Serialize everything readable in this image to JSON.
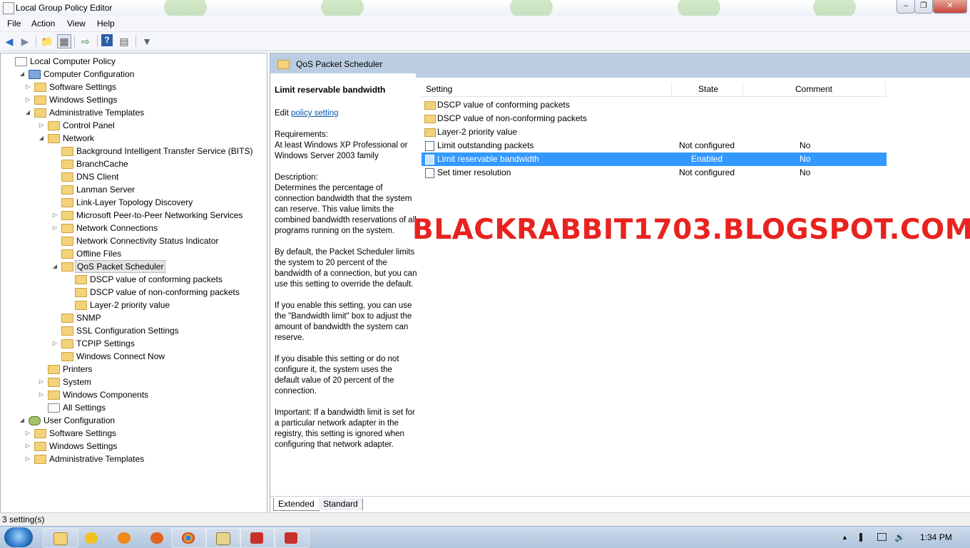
{
  "window": {
    "title": "Local Group Policy Editor"
  },
  "menu": [
    "File",
    "Action",
    "View",
    "Help"
  ],
  "toolbar": {
    "icons": [
      "back-arrow-icon",
      "forward-arrow-icon",
      "up-folder-icon",
      "show-hide-tree-icon",
      "export-list-icon",
      "help-icon",
      "properties-icon",
      "filter-icon"
    ]
  },
  "tree": [
    {
      "label": "Local Computer Policy",
      "level": 0,
      "icon": "doc",
      "arrow": ""
    },
    {
      "label": "Computer Configuration",
      "level": 1,
      "icon": "pc",
      "arrow": "open"
    },
    {
      "label": "Software Settings",
      "level": 2,
      "icon": "folder",
      "arrow": "closed"
    },
    {
      "label": "Windows Settings",
      "level": 2,
      "icon": "folder",
      "arrow": "closed"
    },
    {
      "label": "Administrative Templates",
      "level": 2,
      "icon": "folder",
      "arrow": "open"
    },
    {
      "label": "Control Panel",
      "level": 3,
      "icon": "folder",
      "arrow": "closed"
    },
    {
      "label": "Network",
      "level": 3,
      "icon": "folder",
      "arrow": "open"
    },
    {
      "label": "Background Intelligent Transfer Service (BITS)",
      "level": 4,
      "icon": "folder",
      "arrow": ""
    },
    {
      "label": "BranchCache",
      "level": 4,
      "icon": "folder",
      "arrow": ""
    },
    {
      "label": "DNS Client",
      "level": 4,
      "icon": "folder",
      "arrow": ""
    },
    {
      "label": "Lanman Server",
      "level": 4,
      "icon": "folder",
      "arrow": ""
    },
    {
      "label": "Link-Layer Topology Discovery",
      "level": 4,
      "icon": "folder",
      "arrow": ""
    },
    {
      "label": "Microsoft Peer-to-Peer Networking Services",
      "level": 4,
      "icon": "folder",
      "arrow": "closed"
    },
    {
      "label": "Network Connections",
      "level": 4,
      "icon": "folder",
      "arrow": "closed"
    },
    {
      "label": "Network Connectivity Status Indicator",
      "level": 4,
      "icon": "folder",
      "arrow": ""
    },
    {
      "label": "Offline Files",
      "level": 4,
      "icon": "folder",
      "arrow": ""
    },
    {
      "label": "QoS Packet Scheduler",
      "level": 4,
      "icon": "folder",
      "arrow": "open",
      "selected": true
    },
    {
      "label": "DSCP value of conforming packets",
      "level": 5,
      "icon": "folder",
      "arrow": ""
    },
    {
      "label": "DSCP value of non-conforming packets",
      "level": 5,
      "icon": "folder",
      "arrow": ""
    },
    {
      "label": "Layer-2 priority value",
      "level": 5,
      "icon": "folder",
      "arrow": ""
    },
    {
      "label": "SNMP",
      "level": 4,
      "icon": "folder",
      "arrow": ""
    },
    {
      "label": "SSL Configuration Settings",
      "level": 4,
      "icon": "folder",
      "arrow": ""
    },
    {
      "label": "TCPIP Settings",
      "level": 4,
      "icon": "folder",
      "arrow": "closed"
    },
    {
      "label": "Windows Connect Now",
      "level": 4,
      "icon": "folder",
      "arrow": ""
    },
    {
      "label": "Printers",
      "level": 3,
      "icon": "folder",
      "arrow": ""
    },
    {
      "label": "System",
      "level": 3,
      "icon": "folder",
      "arrow": "closed"
    },
    {
      "label": "Windows Components",
      "level": 3,
      "icon": "folder",
      "arrow": "closed"
    },
    {
      "label": "All Settings",
      "level": 3,
      "icon": "doc",
      "arrow": ""
    },
    {
      "label": "User Configuration",
      "level": 1,
      "icon": "user",
      "arrow": "open"
    },
    {
      "label": "Software Settings",
      "level": 2,
      "icon": "folder",
      "arrow": "closed"
    },
    {
      "label": "Windows Settings",
      "level": 2,
      "icon": "folder",
      "arrow": "closed"
    },
    {
      "label": "Administrative Templates",
      "level": 2,
      "icon": "folder",
      "arrow": "closed"
    }
  ],
  "details": {
    "header_title": "QoS Packet Scheduler",
    "setting_title": "Limit reservable bandwidth",
    "edit_prefix": "Edit ",
    "edit_link": "policy setting ",
    "requirements": "Requirements:\nAt least Windows XP Professional or Windows Server 2003 family",
    "description_paragraphs": [
      "Description:\nDetermines the percentage of connection bandwidth that the system can reserve. This value limits the combined bandwidth reservations of all programs running on the system.",
      "By default, the Packet Scheduler limits the system to 20 percent of the bandwidth of a connection, but you can use this setting to override the default.",
      "If you enable this setting, you can use the \"Bandwidth limit\" box to adjust the amount of bandwidth the system can reserve.",
      "If you disable this setting or do not configure it, the system uses the default value of 20 percent of the connection.",
      "Important: If a bandwidth limit is set for a particular network adapter in the registry, this setting is ignored when configuring that network adapter."
    ]
  },
  "list": {
    "columns": {
      "setting": "Setting",
      "state": "State",
      "comment": "Comment"
    },
    "rows": [
      {
        "type": "folder",
        "setting": "DSCP value of conforming packets",
        "state": "",
        "comment": ""
      },
      {
        "type": "folder",
        "setting": "DSCP value of non-conforming packets",
        "state": "",
        "comment": ""
      },
      {
        "type": "folder",
        "setting": "Layer-2 priority value",
        "state": "",
        "comment": ""
      },
      {
        "type": "policy",
        "setting": "Limit outstanding packets",
        "state": "Not configured",
        "comment": "No"
      },
      {
        "type": "policy",
        "setting": "Limit reservable bandwidth",
        "state": "Enabled",
        "comment": "No",
        "selected": true
      },
      {
        "type": "policy",
        "setting": "Set timer resolution",
        "state": "Not configured",
        "comment": "No"
      }
    ]
  },
  "watermark": "BLACKRABBIT1703.BLOGSPOT.COM",
  "tabs": [
    "Extended",
    "Standard"
  ],
  "status": "3 setting(s)",
  "taskbar": {
    "clock": "1:34 PM",
    "apps": [
      "explorer-icon",
      "avast-icon",
      "orb-icon",
      "firefox-icon",
      "chrome-icon",
      "shell-icon",
      "app-red-icon",
      "app-red2-icon"
    ]
  },
  "colors": {
    "selection": "#3399ff",
    "header_band": "#bccde2",
    "watermark": "#e8231f"
  }
}
